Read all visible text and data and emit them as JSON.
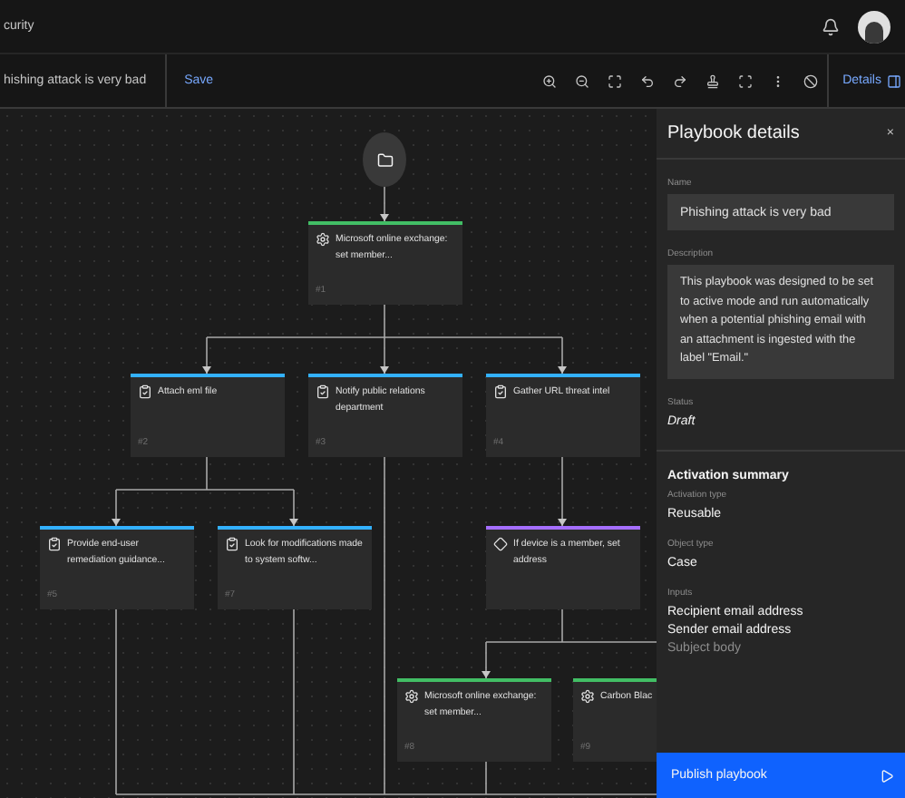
{
  "header": {
    "title": "curity"
  },
  "toolbar": {
    "playbook_name": "hishing attack is very bad",
    "save": "Save",
    "details": "Details"
  },
  "canvas": {
    "nodes": [
      {
        "kind": "integration",
        "title": "Microsoft online exchange: set member...",
        "number": "#1",
        "color": "#42be65"
      },
      {
        "kind": "task",
        "title": "Attach eml file",
        "number": "#2",
        "color": "#33b1ff"
      },
      {
        "kind": "task",
        "title": "Notify public relations department",
        "number": "#3",
        "color": "#33b1ff"
      },
      {
        "kind": "task",
        "title": "Gather URL threat intel",
        "number": "#4",
        "color": "#33b1ff"
      },
      {
        "kind": "task",
        "title": "Provide end-user remediation guidance...",
        "number": "#5",
        "color": "#33b1ff"
      },
      {
        "kind": "task",
        "title": "Look for modifications made to system softw...",
        "number": "#7",
        "color": "#33b1ff"
      },
      {
        "kind": "condition",
        "title": "If device is a member, set address",
        "color": "#a56eff"
      },
      {
        "kind": "integration",
        "title": "Microsoft online exchange: set member...",
        "number": "#8",
        "color": "#42be65"
      },
      {
        "kind": "integration",
        "title": "Carbon Blac",
        "number": "#9",
        "color": "#42be65"
      }
    ]
  },
  "panel": {
    "title": "Playbook details",
    "close": "×",
    "name_label": "Name",
    "name_value": "Phishing attack is very bad",
    "description_label": "Description",
    "description": "This playbook was designed to be set to active mode and run automatically when a potential phishing email with an attachment is ingested with the label \"Email.\"",
    "status_label": "Status",
    "status": "Draft",
    "summary_title": "Activation summary",
    "fields": [
      {
        "label": "Activation type",
        "values": [
          "Reusable"
        ]
      },
      {
        "label": "Object type",
        "values": [
          "Case"
        ]
      },
      {
        "label": "Inputs",
        "values": [
          "Recipient email address",
          "Sender email address",
          "Subject body"
        ]
      }
    ],
    "publish": "Publish playbook"
  }
}
